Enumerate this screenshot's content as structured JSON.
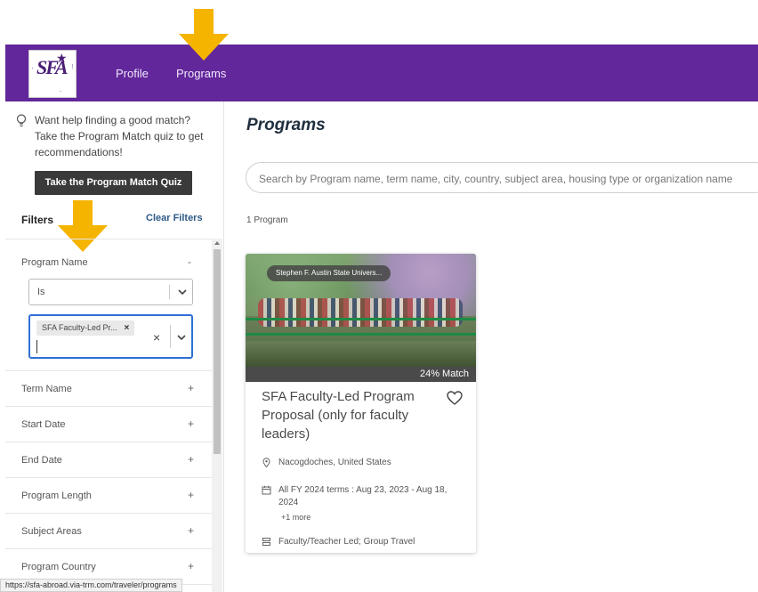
{
  "header": {
    "logo_label": "SFA",
    "nav": {
      "profile": "Profile",
      "programs": "Programs"
    }
  },
  "colors": {
    "brand_purple": "#62279a",
    "annotation_arrow": "#f5b400",
    "focus_blue": "#2e6fd6"
  },
  "sidebar": {
    "help_text": "Want help finding a good match? Take the Program Match quiz to get recommendations!",
    "quiz_button": "Take the Program Match Quiz",
    "filters_title": "Filters",
    "clear_filters": "Clear Filters",
    "program_name": {
      "label": "Program Name",
      "toggle": "-",
      "operator": "Is",
      "selected_chip": "SFA Faculty-Led Pr...",
      "chip_remove": "×",
      "clear": "×"
    },
    "filters": [
      {
        "label": "Term Name",
        "toggle": "+"
      },
      {
        "label": "Start Date",
        "toggle": "+"
      },
      {
        "label": "End Date",
        "toggle": "+"
      },
      {
        "label": "Program Length",
        "toggle": "+"
      },
      {
        "label": "Subject Areas",
        "toggle": "+"
      },
      {
        "label": "Program Country",
        "toggle": "+"
      }
    ]
  },
  "status_bar_url": "https://sfa-abroad.via-trm.com/traveler/programs",
  "main": {
    "title": "Programs",
    "search_placeholder": "Search by Program name, term name, city, country, subject area, housing type or organization name",
    "count": "1 Program",
    "card": {
      "badge": "Stephen F. Austin State Univers...",
      "match": "24% Match",
      "title": "SFA Faculty-Led Program Proposal (only for faculty leaders)",
      "location": "Nacogdoches, United States",
      "terms": "All FY 2024 terms : Aug 23, 2023 - Aug 18, 2024",
      "more": "+1 more",
      "program_type": "Faculty/Teacher Led; Group Travel"
    }
  }
}
